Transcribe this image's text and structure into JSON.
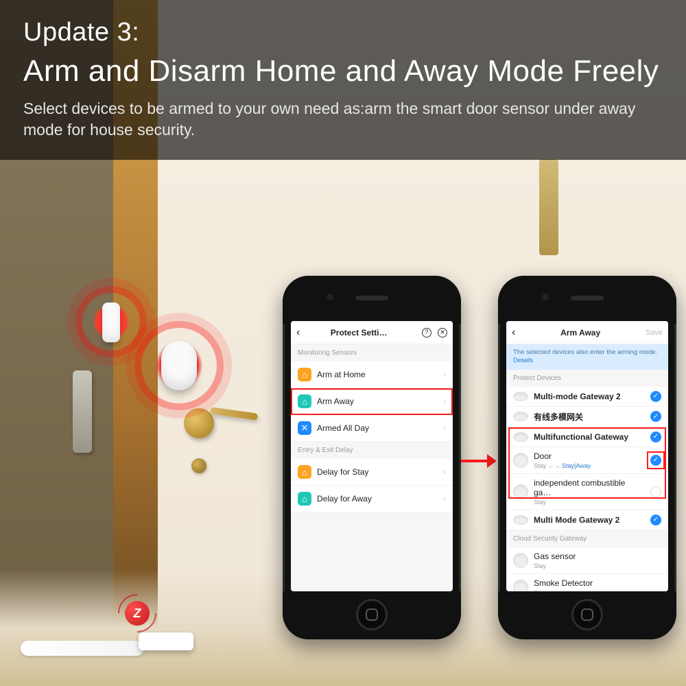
{
  "header": {
    "kicker": "Update 3:",
    "title": "Arm and Disarm Home and Away Mode Freely",
    "body": "Select devices to be armed to your own need as:arm the smart door sensor under away mode for house security."
  },
  "zigbee_glyph": "Z",
  "phone1": {
    "title": "Protect Setti…",
    "section_monitoring": "Monitoring Sensors",
    "items_mon": [
      {
        "icon": "orange",
        "glyph": "⌂",
        "label": "Arm at Home"
      },
      {
        "icon": "teal",
        "glyph": "⌂",
        "label": "Arm Away",
        "hl": true
      },
      {
        "icon": "blue",
        "glyph": "✕",
        "label": "Armed All Day"
      }
    ],
    "section_delay": "Entry & Exit Delay",
    "items_delay": [
      {
        "icon": "orange",
        "glyph": "⌂",
        "label": "Delay for Stay"
      },
      {
        "icon": "teal",
        "glyph": "⌂",
        "label": "Delay for Away"
      }
    ]
  },
  "phone2": {
    "title": "Arm Away",
    "save": "Save",
    "banner": "The selected devices also enter the arming mode.",
    "banner_link": "Details",
    "section_protect": "Protect Devices",
    "gateways": [
      {
        "label": "Multi-mode Gateway 2",
        "checked": true
      },
      {
        "label": "有线多模网关",
        "checked": true
      }
    ],
    "mf_gateway": {
      "label": "Multifunctional Gateway",
      "checked": true,
      "children": [
        {
          "label": "Door",
          "sub_pre": "Stay ←→ ",
          "sub_link": "Stay|Away",
          "checked": true,
          "hl_check": true
        },
        {
          "label": "independent combustible ga…",
          "sub": "Stay",
          "checked": false
        }
      ]
    },
    "gateway_after": {
      "label": "Multi Mode Gateway 2",
      "checked": true
    },
    "section_cloud": "Cloud Security Gateway",
    "cloud": [
      {
        "label": "Gas sensor",
        "sub": "Stay"
      },
      {
        "label": "Smoke Detector",
        "sub": "Stay"
      }
    ]
  }
}
